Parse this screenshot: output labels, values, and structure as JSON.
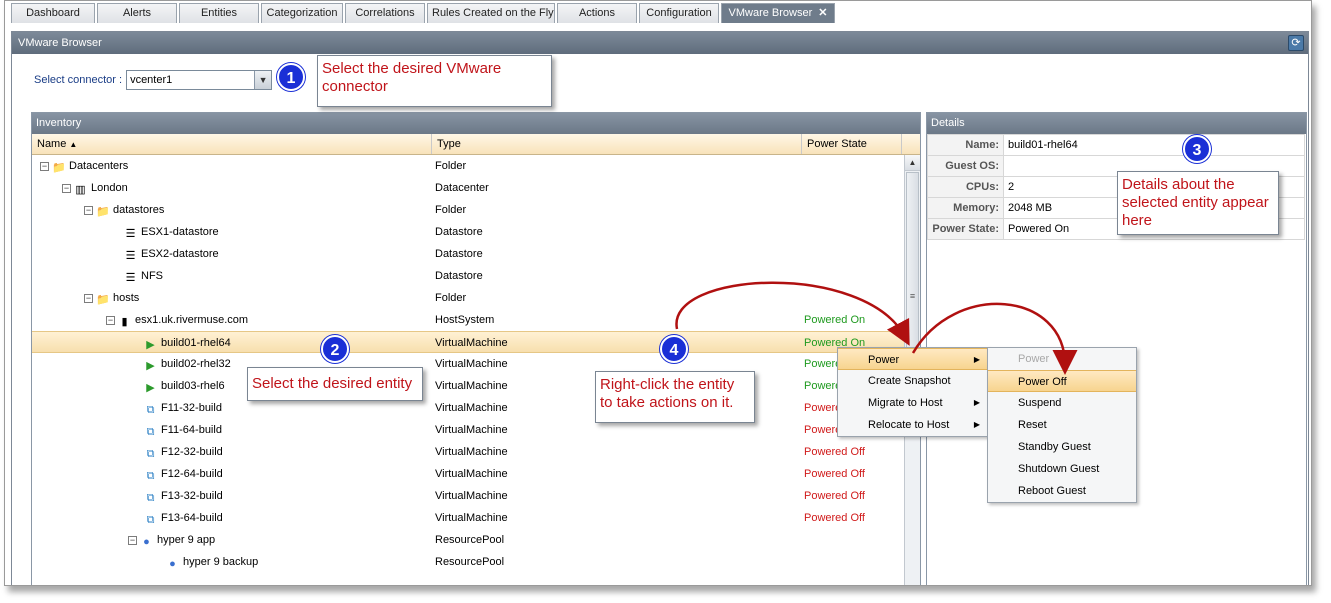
{
  "tabs": [
    "Dashboard",
    "Alerts",
    "Entities",
    "Categorization",
    "Correlations",
    "Rules Created on the Fly",
    "Actions",
    "Configuration",
    "VMware Browser"
  ],
  "active_tab_close": "✕",
  "panel_title": "VMware Browser",
  "connector": {
    "label": "Select connector :",
    "value": "vcenter1"
  },
  "inventory": {
    "title": "Inventory",
    "columns": {
      "name": "Name",
      "type": "Type",
      "power": "Power State"
    },
    "rows": [
      {
        "name": "Datacenters",
        "type": "Folder",
        "power": ""
      },
      {
        "name": "London",
        "type": "Datacenter",
        "power": ""
      },
      {
        "name": "datastores",
        "type": "Folder",
        "power": ""
      },
      {
        "name": "ESX1-datastore",
        "type": "Datastore",
        "power": ""
      },
      {
        "name": "ESX2-datastore",
        "type": "Datastore",
        "power": ""
      },
      {
        "name": "NFS",
        "type": "Datastore",
        "power": ""
      },
      {
        "name": "hosts",
        "type": "Folder",
        "power": ""
      },
      {
        "name": "esx1.uk.rivermuse.com",
        "type": "HostSystem",
        "power": "Powered On"
      },
      {
        "name": "build01-rhel64",
        "type": "VirtualMachine",
        "power": "Powered On"
      },
      {
        "name": "build02-rhel32",
        "type": "VirtualMachine",
        "power": "Powered On"
      },
      {
        "name": "build03-rhel6",
        "type": "VirtualMachine",
        "power": "Powered On"
      },
      {
        "name": "F11-32-build",
        "type": "VirtualMachine",
        "power": "Powered Off"
      },
      {
        "name": "F11-64-build",
        "type": "VirtualMachine",
        "power": "Powered Off"
      },
      {
        "name": "F12-32-build",
        "type": "VirtualMachine",
        "power": "Powered Off"
      },
      {
        "name": "F12-64-build",
        "type": "VirtualMachine",
        "power": "Powered Off"
      },
      {
        "name": "F13-32-build",
        "type": "VirtualMachine",
        "power": "Powered Off"
      },
      {
        "name": "F13-64-build",
        "type": "VirtualMachine",
        "power": "Powered Off"
      },
      {
        "name": "hyper 9 app",
        "type": "ResourcePool",
        "power": ""
      },
      {
        "name": "hyper 9 backup",
        "type": "ResourcePool",
        "power": ""
      }
    ]
  },
  "details": {
    "title": "Details",
    "fields": [
      {
        "key": "Name:",
        "value": "build01-rhel64"
      },
      {
        "key": "Guest OS:",
        "value": ""
      },
      {
        "key": "CPUs:",
        "value": "2"
      },
      {
        "key": "Memory:",
        "value": "2048 MB"
      },
      {
        "key": "Power State:",
        "value": "Powered On"
      }
    ]
  },
  "context_menu": [
    "Power",
    "Create Snapshot",
    "Migrate to Host",
    "Relocate to Host"
  ],
  "power_menu": [
    "Power",
    "Power Off",
    "Suspend",
    "Reset",
    "Standby Guest",
    "Shutdown Guest",
    "Reboot Guest"
  ],
  "callouts": {
    "c1": "Select the desired VMware connector",
    "c2": "Select the desired entity",
    "c3": "Details about the selected entity appear here",
    "c4": "Right-click the entity to take actions on it.",
    "n1": "1",
    "n2": "2",
    "n3": "3",
    "n4": "4"
  },
  "colors": {
    "powered_on": "#1f9a1f",
    "powered_off": "#d01a1a",
    "callout_text": "#c0141a",
    "badge": "#1a2fd6"
  }
}
